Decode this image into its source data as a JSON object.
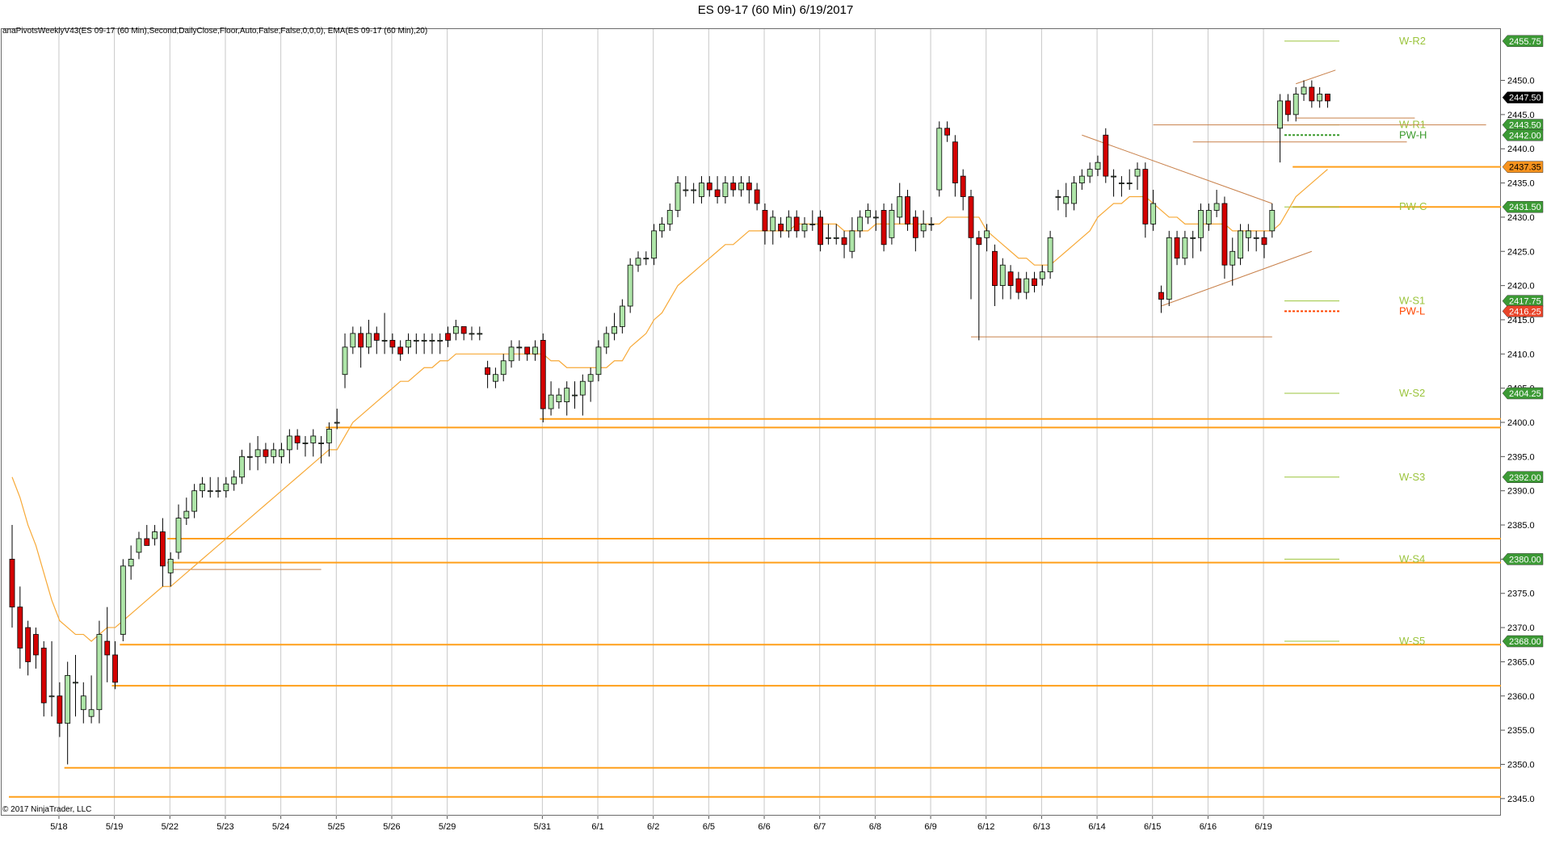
{
  "window": {
    "title": "ES 09-17 (60 Min)  6/19/2017",
    "indicator_label": "anaPivotsWeeklyV43(ES 09-17 (60 Min),Second,DailyClose,Floor,Auto,False,False,0,0,0), EMA(ES 09-17 (60 Min),20)",
    "copyright": "© 2017 NinjaTrader, LLC"
  },
  "colors": {
    "up_candle": "#aee5a8",
    "down_candle": "#d40000",
    "ema": "#f7a937",
    "pivot_line": "#ff9f1a",
    "trendline": "#c8804a",
    "resistance_label": "#9bc43c",
    "pwh_label": "#3a9a2b",
    "pwl_label": "#ff4500",
    "grid": "#c8c8c8"
  },
  "chart_data": {
    "type": "candlestick",
    "instrument": "ES 09-17",
    "interval": "60 Min",
    "ylim": [
      2342.5,
      2457.5
    ],
    "y_ticks": [
      2345,
      2350,
      2355,
      2360,
      2365,
      2370,
      2375,
      2380,
      2385,
      2390,
      2395,
      2400,
      2405,
      2410,
      2415,
      2420,
      2425,
      2430,
      2435,
      2440,
      2445,
      2450
    ],
    "x_ticks": [
      "5/18",
      "5/19",
      "5/22",
      "5/23",
      "5/24",
      "5/25",
      "5/26",
      "5/29",
      "5/31",
      "6/1",
      "6/2",
      "6/5",
      "6/6",
      "6/7",
      "6/8",
      "6/9",
      "6/12",
      "6/13",
      "6/14",
      "6/15",
      "6/16",
      "6/19"
    ],
    "candles": [
      [
        2380,
        2373,
        2385,
        2370
      ],
      [
        2373,
        2367,
        2376,
        2364
      ],
      [
        2370,
        2365,
        2371,
        2363
      ],
      [
        2369,
        2366,
        2370,
        2364
      ],
      [
        2367,
        2359,
        2368,
        2357
      ],
      [
        2360,
        2360,
        2368,
        2357
      ],
      [
        2360,
        2356,
        2362,
        2354
      ],
      [
        2356,
        2363,
        2365,
        2350
      ],
      [
        2362,
        2362,
        2366,
        2357
      ],
      [
        2358,
        2360,
        2362,
        2356
      ],
      [
        2357,
        2358,
        2363,
        2356
      ],
      [
        2358,
        2369,
        2371,
        2356
      ],
      [
        2368,
        2366,
        2373,
        2362
      ],
      [
        2366,
        2362,
        2368,
        2361
      ],
      [
        2369,
        2379,
        2380,
        2368
      ],
      [
        2379,
        2380,
        2382,
        2377
      ],
      [
        2381,
        2383,
        2384,
        2380
      ],
      [
        2383,
        2382,
        2385,
        2382
      ],
      [
        2383,
        2384,
        2385,
        2382
      ],
      [
        2384,
        2379,
        2386,
        2376
      ],
      [
        2378,
        2380,
        2381,
        2376
      ],
      [
        2381,
        2386,
        2388,
        2380
      ],
      [
        2386,
        2387,
        2389,
        2385
      ],
      [
        2387,
        2390,
        2391,
        2386
      ],
      [
        2390,
        2391,
        2392,
        2389
      ],
      [
        2390,
        2390,
        2392,
        2389
      ],
      [
        2390,
        2390,
        2392,
        2389
      ],
      [
        2390,
        2391,
        2392,
        2389
      ],
      [
        2391,
        2392,
        2393,
        2390
      ],
      [
        2392,
        2395,
        2396,
        2391
      ],
      [
        2395,
        2395,
        2397,
        2393
      ],
      [
        2395,
        2396,
        2398,
        2393
      ],
      [
        2396,
        2395,
        2397,
        2394
      ],
      [
        2395,
        2396,
        2397,
        2394
      ],
      [
        2395,
        2396,
        2397,
        2394
      ],
      [
        2396,
        2398,
        2399,
        2394
      ],
      [
        2398,
        2397,
        2399,
        2396
      ],
      [
        2397,
        2397,
        2398,
        2395
      ],
      [
        2397,
        2398,
        2399,
        2395
      ],
      [
        2397,
        2397,
        2398,
        2394
      ],
      [
        2397,
        2399,
        2400,
        2395
      ],
      [
        2400,
        2400,
        2402,
        2399
      ],
      [
        2407,
        2411,
        2413,
        2405
      ],
      [
        2411,
        2413,
        2414,
        2410
      ],
      [
        2413,
        2411,
        2414,
        2408
      ],
      [
        2411,
        2413,
        2415,
        2410
      ],
      [
        2413,
        2412,
        2414,
        2410
      ],
      [
        2412,
        2412,
        2416,
        2410
      ],
      [
        2412,
        2411,
        2413,
        2410
      ],
      [
        2411,
        2410,
        2412,
        2409
      ],
      [
        2411,
        2412,
        2413,
        2410
      ],
      [
        2412,
        2412,
        2413,
        2410
      ],
      [
        2412,
        2412,
        2413,
        2410
      ],
      [
        2412,
        2412,
        2413,
        2410
      ],
      [
        2412,
        2412,
        2413,
        2410
      ],
      [
        2413,
        2412,
        2414,
        2411
      ],
      [
        2413,
        2414,
        2415,
        2412
      ],
      [
        2414,
        2413,
        2414,
        2412
      ],
      [
        2413,
        2413,
        2414,
        2412
      ],
      [
        2413,
        2413,
        2414,
        2412
      ],
      [
        2408,
        2407,
        2409,
        2405
      ],
      [
        2406,
        2407,
        2408,
        2405
      ],
      [
        2407,
        2409,
        2410,
        2406
      ],
      [
        2409,
        2411,
        2412,
        2408
      ],
      [
        2411,
        2411,
        2412,
        2409
      ],
      [
        2411,
        2410,
        2411,
        2409
      ],
      [
        2410,
        2411,
        2412,
        2409
      ],
      [
        2412,
        2402,
        2413,
        2400
      ],
      [
        2402,
        2404,
        2406,
        2401
      ],
      [
        2403,
        2404,
        2405,
        2402
      ],
      [
        2403,
        2405,
        2406,
        2401
      ],
      [
        2404,
        2404,
        2406,
        2402
      ],
      [
        2404,
        2406,
        2407,
        2401
      ],
      [
        2406,
        2407,
        2408,
        2403
      ],
      [
        2407,
        2411,
        2412,
        2406
      ],
      [
        2411,
        2413,
        2414,
        2410
      ],
      [
        2413,
        2414,
        2416,
        2412
      ],
      [
        2414,
        2417,
        2418,
        2413
      ],
      [
        2417,
        2423,
        2424,
        2416
      ],
      [
        2423,
        2424,
        2425,
        2422
      ],
      [
        2424,
        2424,
        2425,
        2423
      ],
      [
        2424,
        2428,
        2429,
        2423
      ],
      [
        2428,
        2429,
        2430,
        2427
      ],
      [
        2429,
        2431,
        2432,
        2428
      ],
      [
        2431,
        2435,
        2436,
        2430
      ],
      [
        2434,
        2434,
        2436,
        2433
      ],
      [
        2434,
        2434,
        2435,
        2432
      ],
      [
        2433,
        2435,
        2436,
        2432
      ],
      [
        2435,
        2434,
        2436,
        2433
      ],
      [
        2434,
        2433,
        2436,
        2432
      ],
      [
        2433,
        2435,
        2436,
        2432
      ],
      [
        2435,
        2434,
        2436,
        2433
      ],
      [
        2434,
        2435,
        2436,
        2433
      ],
      [
        2435,
        2434,
        2436,
        2432
      ],
      [
        2434,
        2432,
        2435,
        2431
      ],
      [
        2431,
        2428,
        2432,
        2426
      ],
      [
        2428,
        2430,
        2431,
        2426
      ],
      [
        2429,
        2428,
        2430,
        2427
      ],
      [
        2428,
        2430,
        2431,
        2427
      ],
      [
        2430,
        2428,
        2431,
        2427
      ],
      [
        2428,
        2429,
        2430,
        2427
      ],
      [
        2429,
        2429,
        2431,
        2428
      ],
      [
        2430,
        2426,
        2431,
        2425
      ],
      [
        2427,
        2427,
        2429,
        2426
      ],
      [
        2427,
        2427,
        2429,
        2426
      ],
      [
        2427,
        2426,
        2428,
        2424
      ],
      [
        2425,
        2428,
        2430,
        2424
      ],
      [
        2428,
        2430,
        2431,
        2427
      ],
      [
        2430,
        2431,
        2432,
        2429
      ],
      [
        2430,
        2430,
        2431,
        2428
      ],
      [
        2431,
        2426,
        2432,
        2425
      ],
      [
        2427,
        2431,
        2432,
        2426
      ],
      [
        2430,
        2433,
        2435,
        2429
      ],
      [
        2433,
        2429,
        2434,
        2428
      ],
      [
        2430,
        2427,
        2431,
        2425
      ],
      [
        2428,
        2429,
        2431,
        2427
      ],
      [
        2429,
        2429,
        2430,
        2428
      ],
      [
        2434,
        2443,
        2444,
        2433
      ],
      [
        2443,
        2442,
        2444,
        2441
      ],
      [
        2441,
        2435,
        2442,
        2433
      ],
      [
        2436,
        2433,
        2437,
        2431
      ],
      [
        2433,
        2427,
        2434,
        2418
      ],
      [
        2427,
        2426,
        2428,
        2412
      ],
      [
        2427,
        2428,
        2429,
        2425
      ],
      [
        2425,
        2420,
        2426,
        2417
      ],
      [
        2420,
        2423,
        2424,
        2418
      ],
      [
        2422,
        2420,
        2423,
        2418
      ],
      [
        2421,
        2419,
        2422,
        2418
      ],
      [
        2419,
        2421,
        2422,
        2418
      ],
      [
        2421,
        2420,
        2422,
        2419
      ],
      [
        2421,
        2422,
        2423,
        2420
      ],
      [
        2422,
        2427,
        2428,
        2421
      ],
      [
        2433,
        2433,
        2434,
        2431
      ],
      [
        2432,
        2433,
        2435,
        2430
      ],
      [
        2432,
        2435,
        2436,
        2431
      ],
      [
        2435,
        2436,
        2437,
        2434
      ],
      [
        2436,
        2437,
        2438,
        2435
      ],
      [
        2437,
        2438,
        2439,
        2436
      ],
      [
        2442,
        2436,
        2443,
        2435
      ],
      [
        2436,
        2436,
        2437,
        2433
      ],
      [
        2435,
        2435,
        2436,
        2433
      ],
      [
        2435,
        2435,
        2437,
        2434
      ],
      [
        2436,
        2437,
        2438,
        2434
      ],
      [
        2437,
        2429,
        2438,
        2427
      ],
      [
        2429,
        2432,
        2434,
        2428
      ],
      [
        2419,
        2418,
        2420,
        2416
      ],
      [
        2418,
        2427,
        2428,
        2417
      ],
      [
        2427,
        2424,
        2428,
        2423
      ],
      [
        2424,
        2427,
        2428,
        2423
      ],
      [
        2427,
        2427,
        2428,
        2424
      ],
      [
        2427,
        2431,
        2432,
        2425
      ],
      [
        2429,
        2431,
        2432,
        2428
      ],
      [
        2431,
        2432,
        2434,
        2430
      ],
      [
        2432,
        2423,
        2433,
        2421
      ],
      [
        2423,
        2425,
        2427,
        2420
      ],
      [
        2424,
        2428,
        2429,
        2423
      ],
      [
        2427,
        2428,
        2429,
        2425
      ],
      [
        2427,
        2427,
        2428,
        2425
      ],
      [
        2427,
        2426,
        2428,
        2424
      ],
      [
        2428,
        2431,
        2432,
        2427
      ],
      [
        2443,
        2447,
        2448,
        2438
      ],
      [
        2447,
        2445,
        2448,
        2444
      ],
      [
        2445,
        2448,
        2449,
        2444
      ],
      [
        2448,
        2449,
        2450,
        2447
      ],
      [
        2449,
        2447,
        2450,
        2446
      ],
      [
        2447,
        2448,
        2449,
        2446
      ],
      [
        2448,
        2447,
        2448,
        2446
      ]
    ],
    "ema_20": [
      2392,
      2389,
      2385,
      2382,
      2378,
      2374,
      2371,
      2370,
      2369,
      2369,
      2368,
      2369,
      2370,
      2370,
      2371,
      2372,
      2373,
      2374,
      2375,
      2376,
      2376,
      2377,
      2378,
      2379,
      2380,
      2381,
      2382,
      2383,
      2384,
      2385,
      2386,
      2387,
      2388,
      2389,
      2390,
      2391,
      2392,
      2393,
      2394,
      2395,
      2396,
      2396,
      2398,
      2400,
      2401,
      2402,
      2403,
      2404,
      2405,
      2406,
      2406,
      2407,
      2408,
      2408,
      2409,
      2409,
      2410,
      2410,
      2410,
      2410,
      2410,
      2410,
      2410,
      2410,
      2410,
      2410,
      2410,
      2410,
      2409,
      2409,
      2408,
      2408,
      2408,
      2408,
      2408,
      2408,
      2409,
      2409,
      2411,
      2412,
      2413,
      2415,
      2416,
      2418,
      2420,
      2421,
      2422,
      2423,
      2424,
      2425,
      2426,
      2426,
      2427,
      2428,
      2428,
      2428,
      2428,
      2428,
      2428,
      2429,
      2429,
      2429,
      2429,
      2429,
      2429,
      2428,
      2428,
      2428,
      2428,
      2429,
      2429,
      2429,
      2429,
      2429,
      2429,
      2429,
      2429,
      2429,
      2430,
      2430,
      2430,
      2430,
      2430,
      2428,
      2427,
      2426,
      2425,
      2424,
      2424,
      2423,
      2423,
      2423,
      2424,
      2425,
      2426,
      2427,
      2428,
      2430,
      2431,
      2432,
      2432,
      2433,
      2433,
      2433,
      2432,
      2431,
      2430,
      2430,
      2429,
      2429,
      2429,
      2429,
      2429,
      2429,
      2428,
      2428,
      2428,
      2428,
      2428,
      2428,
      2429,
      2431,
      2433,
      2434,
      2435,
      2436,
      2437
    ],
    "price_tags": [
      {
        "price": 2455.75,
        "label": "2455.75",
        "style": "green"
      },
      {
        "price": 2447.5,
        "label": "2447.50",
        "style": "black"
      },
      {
        "price": 2443.5,
        "label": "2443.50",
        "style": "green"
      },
      {
        "price": 2442.0,
        "label": "2442.00",
        "style": "green"
      },
      {
        "price": 2437.35,
        "label": "2437.35",
        "style": "orange"
      },
      {
        "price": 2431.5,
        "label": "2431.50",
        "style": "green"
      },
      {
        "price": 2417.75,
        "label": "2417.75",
        "style": "green"
      },
      {
        "price": 2416.25,
        "label": "2416.25",
        "style": "red"
      },
      {
        "price": 2404.25,
        "label": "2404.25",
        "style": "green"
      },
      {
        "price": 2392.0,
        "label": "2392.00",
        "style": "green"
      },
      {
        "price": 2380.0,
        "label": "2380.00",
        "style": "green"
      },
      {
        "price": 2368.0,
        "label": "2368.00",
        "style": "green"
      }
    ],
    "pivot_levels": [
      {
        "name": "W-R2",
        "price": 2455.75,
        "color": "#9bc43c"
      },
      {
        "name": "W-R1",
        "price": 2443.5,
        "color": "#9bc43c"
      },
      {
        "name": "PW-H",
        "price": 2442.0,
        "color": "#3a9a2b",
        "dotted": true
      },
      {
        "name": "PW-C",
        "price": 2431.5,
        "color": "#9bc43c"
      },
      {
        "name": "W-S1",
        "price": 2417.75,
        "color": "#9bc43c"
      },
      {
        "name": "PW-L",
        "price": 2416.25,
        "color": "#ff4500",
        "dotted": true
      },
      {
        "name": "W-S2",
        "price": 2404.25,
        "color": "#9bc43c"
      },
      {
        "name": "W-S3",
        "price": 2392.0,
        "color": "#9bc43c"
      },
      {
        "name": "W-S4",
        "price": 2380.0,
        "color": "#9bc43c"
      },
      {
        "name": "W-S5",
        "price": 2368.0,
        "color": "#9bc43c"
      }
    ],
    "orange_levels": [
      2437.35,
      2431.5,
      2400.5,
      2399.25,
      2383.0,
      2379.5,
      2367.5,
      2361.5,
      2349.5,
      2345.25
    ],
    "trendlines": [
      {
        "from": [
          144,
          2443.5
        ],
        "to": [
          186,
          2443.5
        ]
      },
      {
        "from": [
          149,
          2441.0
        ],
        "to": [
          176,
          2441.0
        ]
      },
      {
        "from": [
          20,
          2378.5
        ],
        "to": [
          39,
          2378.5
        ]
      },
      {
        "from": [
          121,
          2412.5
        ],
        "to": [
          159,
          2412.5
        ]
      },
      {
        "from": [
          135,
          2442.0
        ],
        "to": [
          159,
          2432.0
        ]
      },
      {
        "from": [
          145,
          2417.0
        ],
        "to": [
          164,
          2425.0
        ]
      },
      {
        "from": [
          162,
          2449.5
        ],
        "to": [
          167,
          2451.5
        ]
      },
      {
        "from": [
          162,
          2444.5
        ],
        "to": [
          177,
          2444.5
        ]
      }
    ]
  }
}
